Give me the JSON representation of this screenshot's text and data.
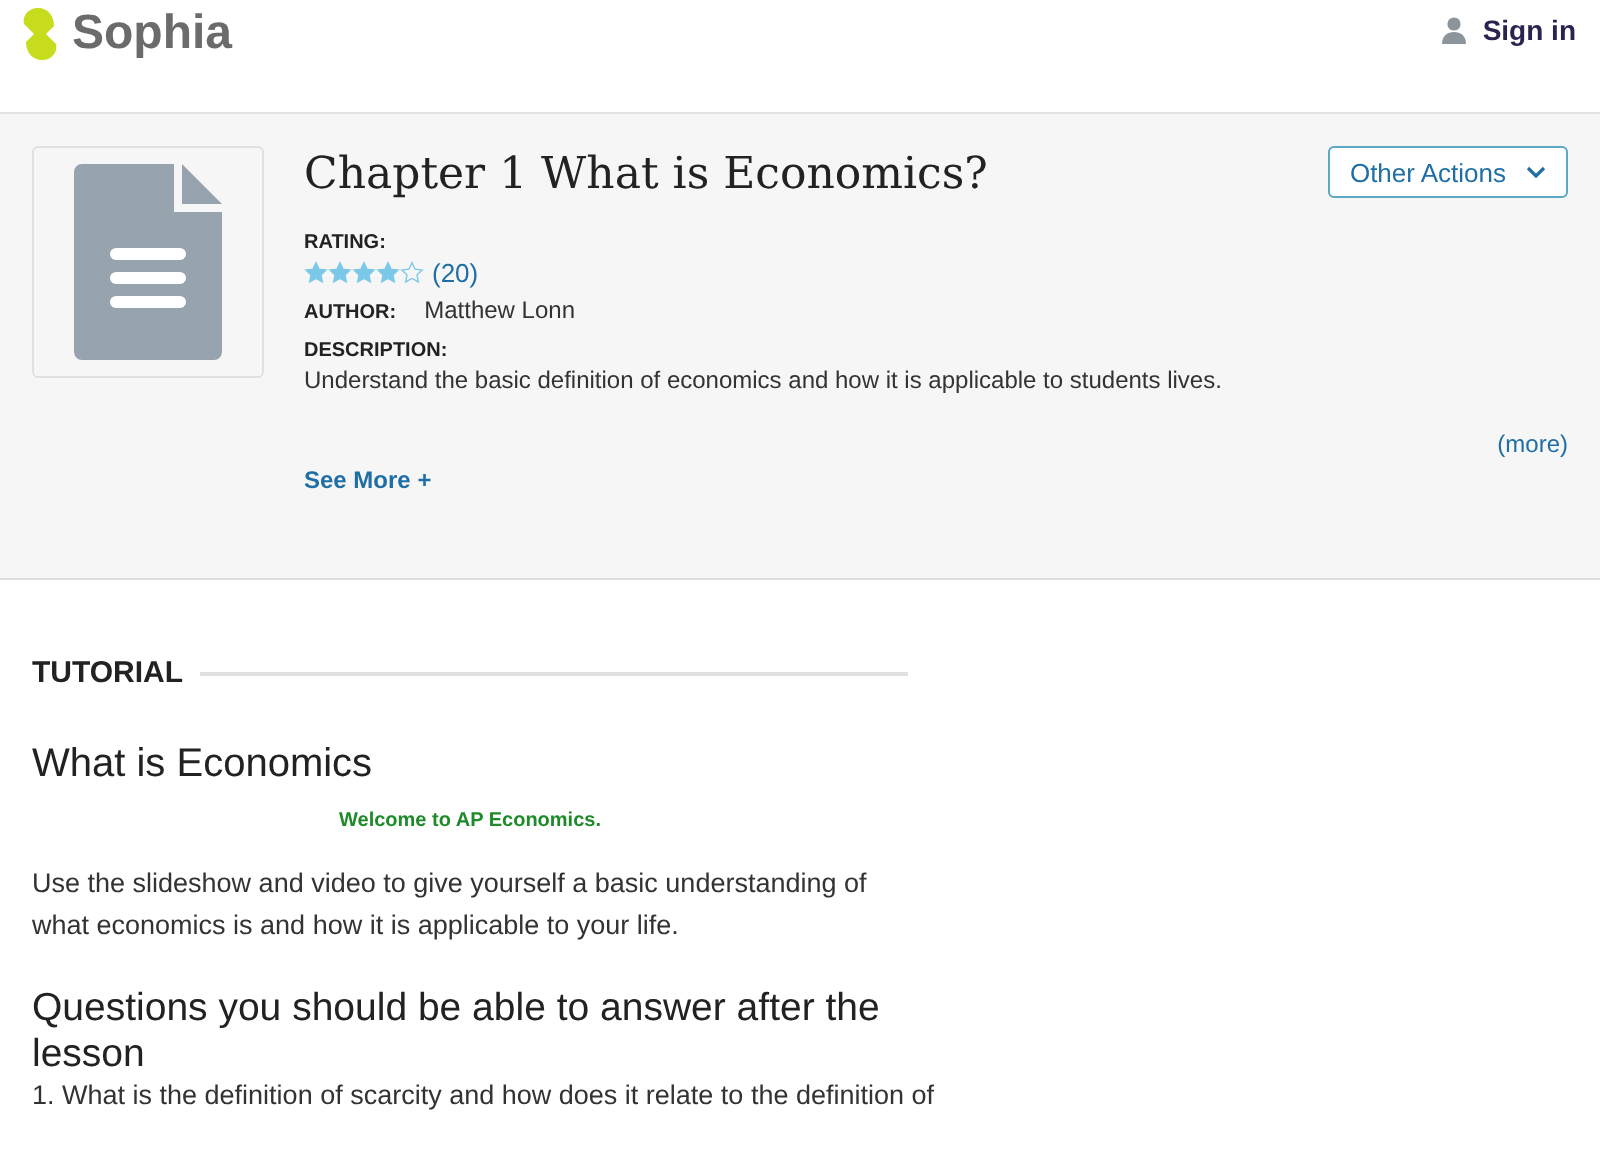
{
  "header": {
    "logo": "Sophia",
    "sign_in": "Sign in"
  },
  "resource": {
    "title": "Chapter 1 What is Economics?",
    "actions_button": "Other Actions",
    "rating_label": "RATING:",
    "stars": 4,
    "rating_count": "(20)",
    "author_label": "AUTHOR:",
    "author": "Matthew Lonn",
    "description_label": "DESCRIPTION:",
    "description": "Understand the basic definition of economics and how it is applicable to students lives.",
    "more_link": "(more)",
    "see_more": "See More +"
  },
  "tutorial": {
    "section_label": "TUTORIAL",
    "heading": "What is Economics",
    "welcome_link": "Welcome to AP Economics.",
    "intro": "Use the slideshow and video to give yourself a basic understanding of what economics is and how it is applicable to your life.",
    "questions_heading": "Questions you should be able to answer after the lesson",
    "question_1": "1. What is the definition of scarcity and how does it relate to the definition of"
  }
}
